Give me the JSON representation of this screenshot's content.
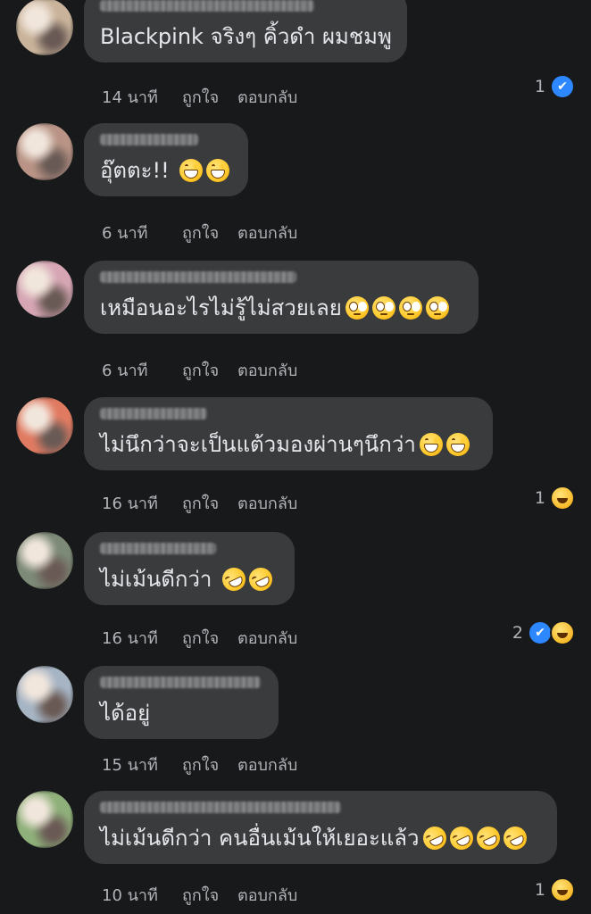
{
  "comments": [
    {
      "text": "Blackpink จริงๆ คิ้วดำ ผมชมพู",
      "emojis": [],
      "time": "14 นาที",
      "like_label": "ถูกใจ",
      "reply_label": "ตอบกลับ",
      "reaction_count": "1",
      "reactions": [
        "like"
      ],
      "avatar_color": "#c9b39a"
    },
    {
      "text": "อุ๊ตตะ!!",
      "emojis": [
        "grinning-face-emoji",
        "grinning-face-emoji"
      ],
      "time": "6 นาที",
      "like_label": "ถูกใจ",
      "reply_label": "ตอบกลับ",
      "reaction_count": "",
      "reactions": [],
      "avatar_color": "#b99486"
    },
    {
      "text": "เหมือนอะไรไม่รู้ไม่สวยเลย",
      "emojis": [
        "eye-roll-emoji",
        "eye-roll-emoji",
        "eye-roll-emoji",
        "eye-roll-emoji"
      ],
      "time": "6 นาที",
      "like_label": "ถูกใจ",
      "reply_label": "ตอบกลับ",
      "reaction_count": "",
      "reactions": [],
      "avatar_color": "#d6a6b4"
    },
    {
      "text": "ไม่นึกว่าจะเป็นแต้วมองผ่านๆนึกว่า",
      "emojis": [
        "grinning-face-emoji",
        "grinning-face-emoji"
      ],
      "time": "16 นาที",
      "like_label": "ถูกใจ",
      "reply_label": "ตอบกลับ",
      "reaction_count": "1",
      "reactions": [
        "haha"
      ],
      "avatar_color": "#e07b62"
    },
    {
      "text": "ไม่เม้นดีกว่า",
      "emojis": [
        "rofl-emoji",
        "rofl-emoji"
      ],
      "time": "16 นาที",
      "like_label": "ถูกใจ",
      "reply_label": "ตอบกลับ",
      "reaction_count": "2",
      "reactions": [
        "like",
        "haha"
      ],
      "avatar_color": "#7d8a78"
    },
    {
      "text": "ได้อยู่",
      "emojis": [],
      "time": "15 นาที",
      "like_label": "ถูกใจ",
      "reply_label": "ตอบกลับ",
      "reaction_count": "",
      "reactions": [],
      "avatar_color": "#a6b4c4"
    },
    {
      "text": "ไม่เม้นดีกว่า คนอื่นเม้นให้เยอะแล้ว",
      "emojis": [
        "rofl-emoji",
        "rofl-emoji",
        "rofl-emoji",
        "rofl-emoji"
      ],
      "time": "10 นาที",
      "like_label": "ถูกใจ",
      "reply_label": "ตอบกลับ",
      "reaction_count": "1",
      "reactions": [
        "haha"
      ],
      "avatar_color": "#8fb07a"
    }
  ],
  "colors": {
    "background": "#18191a",
    "bubble": "#3a3b3c",
    "text": "#e4e6eb",
    "meta": "#b0b3b8",
    "like_reaction": "#2d88ff",
    "haha_reaction": "#f7b928"
  }
}
